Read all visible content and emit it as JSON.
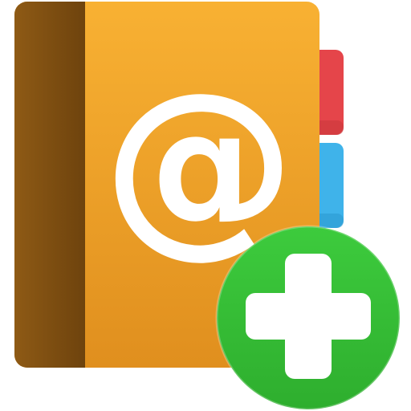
{
  "icon": {
    "glyph": "@",
    "semantic": "address-book-add-icon",
    "badge_semantic": "plus-icon"
  },
  "colors": {
    "cover_orange": "#F3A12A",
    "cover_orange_light": "#F8B133",
    "cover_orange_dark": "#E08F1E",
    "spine_brown": "#8E5A15",
    "spine_brown_dark": "#6E430D",
    "tab_red": "#E5454A",
    "tab_red_dark": "#C9373B",
    "tab_blue": "#3FB3EA",
    "tab_blue_dark": "#2A97CE",
    "badge_green": "#3DCB3D",
    "badge_green_dark": "#2EAE2E",
    "glyph_white": "#FFFFFF"
  }
}
